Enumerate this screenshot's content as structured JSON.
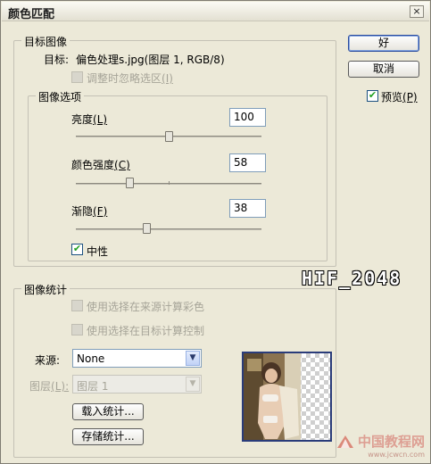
{
  "window": {
    "title": "颜色匹配",
    "close_label": "×"
  },
  "target_group": {
    "title": "目标图像",
    "target_label": "目标:",
    "target_value": "偏色处理s.jpg(图层 1, RGB/8)",
    "ignore_selection_label": "调整时忽略选区",
    "ignore_selection_hotkey": "(I)"
  },
  "image_options": {
    "title": "图像选项",
    "luminance": {
      "label": "亮度",
      "hotkey": "(L)",
      "value": "100",
      "slider_fraction": 0.5
    },
    "color_intensity": {
      "label": "颜色强度",
      "hotkey": "(C)",
      "value": "58",
      "slider_fraction": 0.29
    },
    "fade": {
      "label": "渐隐",
      "hotkey": "(F)",
      "value": "38",
      "slider_fraction": 0.38
    },
    "neutralize": {
      "label": "中性",
      "checked": true
    }
  },
  "buttons": {
    "ok": "好",
    "cancel": "取消"
  },
  "preview": {
    "label": "预览",
    "hotkey": "(P)",
    "checked": true
  },
  "watermark_text": "HIF_2048",
  "statistics": {
    "title": "图像统计",
    "use_source_selection": "使用选择在来源计算彩色",
    "use_target_selection": "使用选择在目标计算控制",
    "source_label": "来源:",
    "source_value": "None",
    "layer_label": "图层",
    "layer_hotkey": "(L):",
    "layer_value": "图层 1",
    "load_stats": "载入统计...",
    "save_stats": "存储统计..."
  },
  "logo": {
    "name": "中国教程网",
    "url": "www.jcwcn.com"
  },
  "colors": {
    "accent": "#2a4c9f",
    "check": "#21a121"
  }
}
